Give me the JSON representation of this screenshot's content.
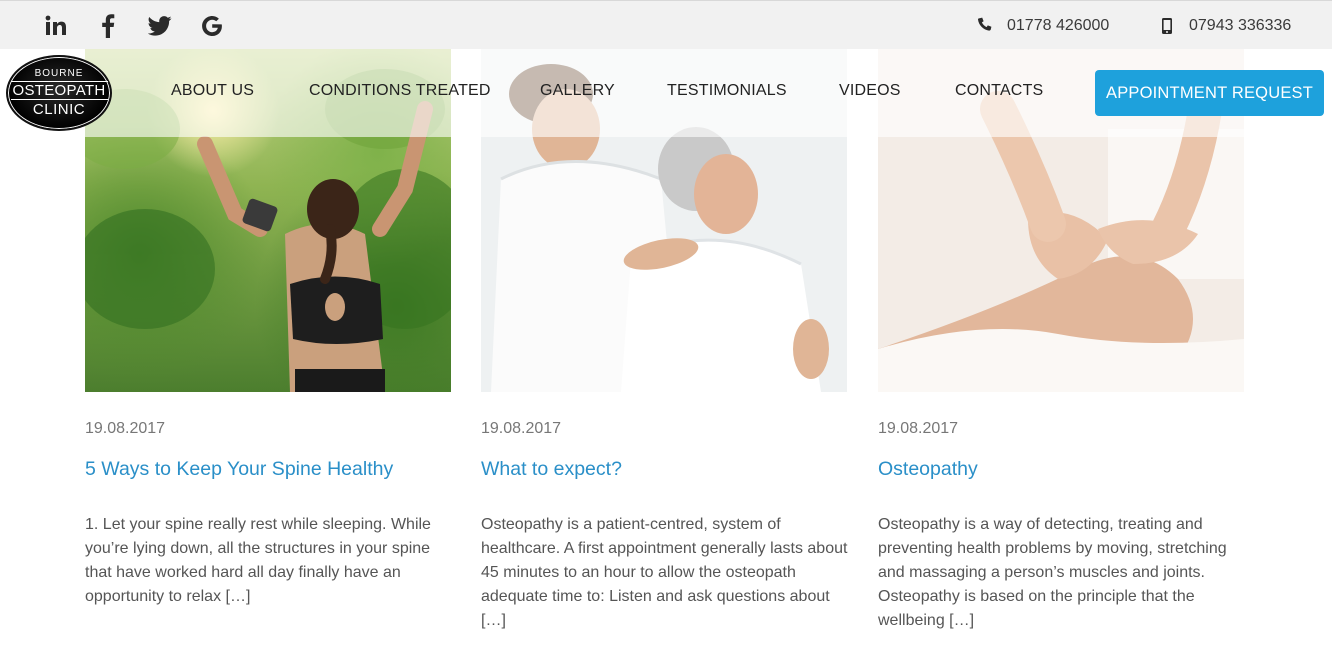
{
  "topbar": {
    "social": [
      {
        "name": "linkedin-icon",
        "glyph": "in"
      },
      {
        "name": "facebook-icon",
        "glyph": "f"
      },
      {
        "name": "twitter-icon",
        "glyph": "t"
      },
      {
        "name": "google-icon",
        "glyph": "G"
      }
    ],
    "phone_landline": "01778 426000",
    "phone_mobile": "07943 336336"
  },
  "logo": {
    "line1": "BOURNE",
    "line2": "OSTEOPATH",
    "line3": "CLINIC"
  },
  "nav": {
    "items": [
      "ABOUT US",
      "CONDITIONS TREATED",
      "GALLERY",
      "TESTIMONIALS",
      "VIDEOS",
      "CONTACTS"
    ],
    "cta": "APPOINTMENT REQUEST"
  },
  "posts": [
    {
      "date": "19.08.2017",
      "title": "5 Ways to Keep Your Spine Healthy",
      "excerpt": "1. Let your spine really rest while sleeping. While you’re lying down, all the structures in your spine that have worked hard all day finally have an opportunity to relax […]"
    },
    {
      "date": "19.08.2017",
      "title": "What to expect?",
      "excerpt": "Osteopathy is a patient-centred, system of healthcare. A first appointment generally lasts about 45 minutes to an hour to allow the osteopath adequate time to: Listen and ask questions about […]"
    },
    {
      "date": "19.08.2017",
      "title": "Osteopathy",
      "excerpt": "Osteopathy is a way of detecting, treating and preventing health problems by moving, stretching and massaging a person’s muscles and joints. Osteopathy is based on the principle that the wellbeing […]"
    }
  ],
  "colors": {
    "accent": "#1ea1dc",
    "title_link": "#2a8fc8",
    "topbar_bg": "#f1f1f1"
  }
}
